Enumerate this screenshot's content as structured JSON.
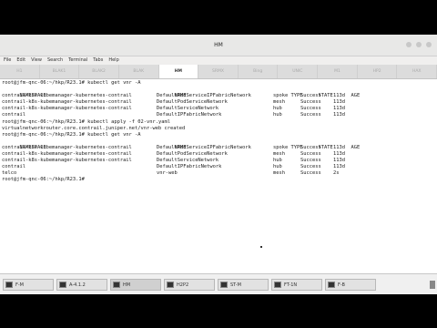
{
  "window": {
    "title": "HM"
  },
  "menu": [
    "File",
    "Edit",
    "View",
    "Search",
    "Terminal",
    "Tabs",
    "Help"
  ],
  "tabs": [
    {
      "label": "H1",
      "active": false
    },
    {
      "label": "BLAK1",
      "active": false
    },
    {
      "label": "BLAK2",
      "active": false
    },
    {
      "label": "BLAK",
      "active": false
    },
    {
      "label": "HM",
      "active": true
    },
    {
      "label": "SRMX",
      "active": false
    },
    {
      "label": "Bing",
      "active": false
    },
    {
      "label": "UNIC",
      "active": false
    },
    {
      "label": "M1",
      "active": false
    },
    {
      "label": "HP2",
      "active": false
    },
    {
      "label": "HAX",
      "active": false
    }
  ],
  "terminal": {
    "prompt1": "root@jfm-qnc-06:~/hkp/R23.1# kubectl get vnr -A",
    "headers": [
      "NAMESPACE",
      "NAME",
      "TYPE",
      "STATE",
      "AGE"
    ],
    "rows1": [
      [
        "contrail-k8s-kubemanager-kubernetes-contrail",
        "DefaultPodServiceIPFabricNetwork",
        "spoke",
        "Success",
        "113d"
      ],
      [
        "contrail-k8s-kubemanager-kubernetes-contrail",
        "DefaultPodServiceNetwork",
        "mesh",
        "Success",
        "113d"
      ],
      [
        "contrail-k8s-kubemanager-kubernetes-contrail",
        "DefaultServiceNetwork",
        "hub",
        "Success",
        "113d"
      ],
      [
        "contrail",
        "DefaultIPFabricNetwork",
        "hub",
        "Success",
        "113d"
      ]
    ],
    "prompt2": "root@jfm-qnc-06:~/hkp/R23.1# kubectl apply -f 02-vnr.yaml",
    "output2": "virtualnetworkrouter.core.contrail.juniper.net/vnr-web created",
    "prompt3": "root@jfm-qnc-06:~/hkp/R23.1# kubectl get vnr -A",
    "rows2": [
      [
        "contrail-k8s-kubemanager-kubernetes-contrail",
        "DefaultPodServiceIPFabricNetwork",
        "spoke",
        "Success",
        "113d"
      ],
      [
        "contrail-k8s-kubemanager-kubernetes-contrail",
        "DefaultPodServiceNetwork",
        "mesh",
        "Success",
        "113d"
      ],
      [
        "contrail-k8s-kubemanager-kubernetes-contrail",
        "DefaultServiceNetwork",
        "hub",
        "Success",
        "113d"
      ],
      [
        "contrail",
        "DefaultIPFabricNetwork",
        "hub",
        "Success",
        "113d"
      ],
      [
        "telco",
        "vnr-web",
        "mesh",
        "Success",
        "2s"
      ]
    ],
    "prompt4": "root@jfm-qnc-06:~/hkp/R23.1#"
  },
  "taskbar": [
    {
      "label": "F-M",
      "active": false
    },
    {
      "label": "A-4.1.2",
      "active": false
    },
    {
      "label": "HM",
      "active": true
    },
    {
      "label": "H2P2",
      "active": false
    },
    {
      "label": "ST-M",
      "active": false
    },
    {
      "label": "FT-1N",
      "active": false
    },
    {
      "label": "F-B",
      "active": false
    }
  ]
}
